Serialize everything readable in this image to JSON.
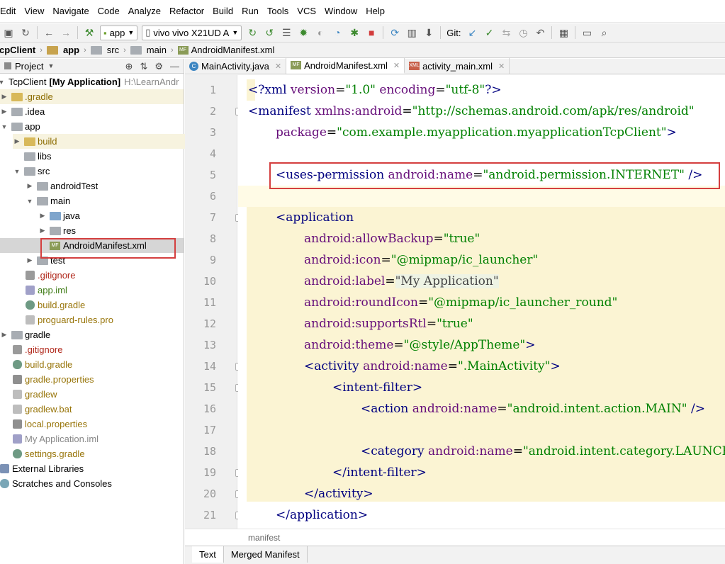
{
  "menubar": {
    "items": [
      "Edit",
      "View",
      "Navigate",
      "Code",
      "Analyze",
      "Refactor",
      "Build",
      "Run",
      "Tools",
      "VCS",
      "Window",
      "Help"
    ]
  },
  "toolbar": {
    "module_combo": "app",
    "device_combo": "vivo vivo X21UD A",
    "git_label": "Git:"
  },
  "navbar": {
    "crumbs": [
      "TcpClient",
      "app",
      "src",
      "main",
      "AndroidManifest.xml"
    ]
  },
  "project_panel": {
    "title": "Project",
    "root_name": "TcpClient",
    "root_module": "[My Application]",
    "root_path": "H:\\LearnAndr",
    "items": [
      {
        "label": ".gradle"
      },
      {
        "label": ".idea"
      },
      {
        "label": "app"
      },
      {
        "label": "build"
      },
      {
        "label": "libs"
      },
      {
        "label": "src"
      },
      {
        "label": "androidTest"
      },
      {
        "label": "main"
      },
      {
        "label": "java"
      },
      {
        "label": "res"
      },
      {
        "label": "AndroidManifest.xml"
      },
      {
        "label": "test"
      },
      {
        "label": ".gitignore"
      },
      {
        "label": "app.iml"
      },
      {
        "label": "build.gradle"
      },
      {
        "label": "proguard-rules.pro"
      },
      {
        "label": "gradle"
      },
      {
        "label": ".gitignore"
      },
      {
        "label": "build.gradle"
      },
      {
        "label": "gradle.properties"
      },
      {
        "label": "gradlew"
      },
      {
        "label": "gradlew.bat"
      },
      {
        "label": "local.properties"
      },
      {
        "label": "My Application.iml"
      },
      {
        "label": "settings.gradle"
      },
      {
        "label": "External Libraries"
      },
      {
        "label": "Scratches and Consoles"
      }
    ]
  },
  "editor_tabs": [
    {
      "label": "MainActivity.java",
      "icon": "java-class-icon"
    },
    {
      "label": "AndroidManifest.xml",
      "icon": "manifest-icon"
    },
    {
      "label": "activity_main.xml",
      "icon": "layout-xml-icon"
    }
  ],
  "code": {
    "line_numbers": [
      "1",
      "2",
      "3",
      "4",
      "5",
      "6",
      "7",
      "8",
      "9",
      "10",
      "11",
      "12",
      "13",
      "14",
      "15",
      "16",
      "17",
      "18",
      "19",
      "20",
      "21"
    ],
    "l1": {
      "a": "<?xml ",
      "b": "version",
      "c": "=",
      "d": "\"1.0\"",
      "e": " ",
      "f": "encoding",
      "g": "=",
      "h": "\"utf-8\"",
      "i": "?>"
    },
    "l2": {
      "a": "<manifest ",
      "b": "xmlns:android",
      "c": "=",
      "d": "\"http://schemas.android.com/apk/res/android\""
    },
    "l3": {
      "b": "package",
      "c": "=",
      "d": "\"com.example.myapplication.myapplicationTcpClient\"",
      "e": ">"
    },
    "l5": {
      "a": "<uses-permission ",
      "b": "android:name",
      "c": "=",
      "d": "\"android.permission.INTERNET\"",
      "e": " />"
    },
    "l7": {
      "a": "<application"
    },
    "l8": {
      "b": "android:allowBackup",
      "c": "=",
      "d": "\"true\""
    },
    "l9": {
      "b": "android:icon",
      "c": "=",
      "d": "\"@mipmap/ic_launcher\""
    },
    "l10": {
      "b": "android:label",
      "c": "=",
      "d": "\"My Application\""
    },
    "l11": {
      "b": "android:roundIcon",
      "c": "=",
      "d": "\"@mipmap/ic_launcher_round\""
    },
    "l12": {
      "b": "android:supportsRtl",
      "c": "=",
      "d": "\"true\""
    },
    "l13": {
      "b": "android:theme",
      "c": "=",
      "d": "\"@style/AppTheme\"",
      "e": ">"
    },
    "l14": {
      "a": "<activity ",
      "b": "android:name",
      "c": "=",
      "d": "\".MainActivity\"",
      "e": ">"
    },
    "l15": {
      "a": "<intent-filter>"
    },
    "l16": {
      "a": "<action ",
      "b": "android:name",
      "c": "=",
      "d": "\"android.intent.action.MAIN\"",
      "e": " />"
    },
    "l18": {
      "a": "<category ",
      "b": "android:name",
      "c": "=",
      "d": "\"android.intent.category.LAUNCHER\"",
      "e": " />"
    },
    "l19": {
      "a": "</intent-filter>"
    },
    "l20": {
      "a": "</activity>"
    },
    "l21": {
      "a": "</application>"
    }
  },
  "status": {
    "breadcrumb": "manifest"
  },
  "bottom_tabs": [
    "Text",
    "Merged Manifest"
  ],
  "colors": {
    "tag": "#000080",
    "attr": "#660e7a",
    "string": "#008000",
    "highlight": "#fbf4d3",
    "annotation": "#d43f3f"
  }
}
